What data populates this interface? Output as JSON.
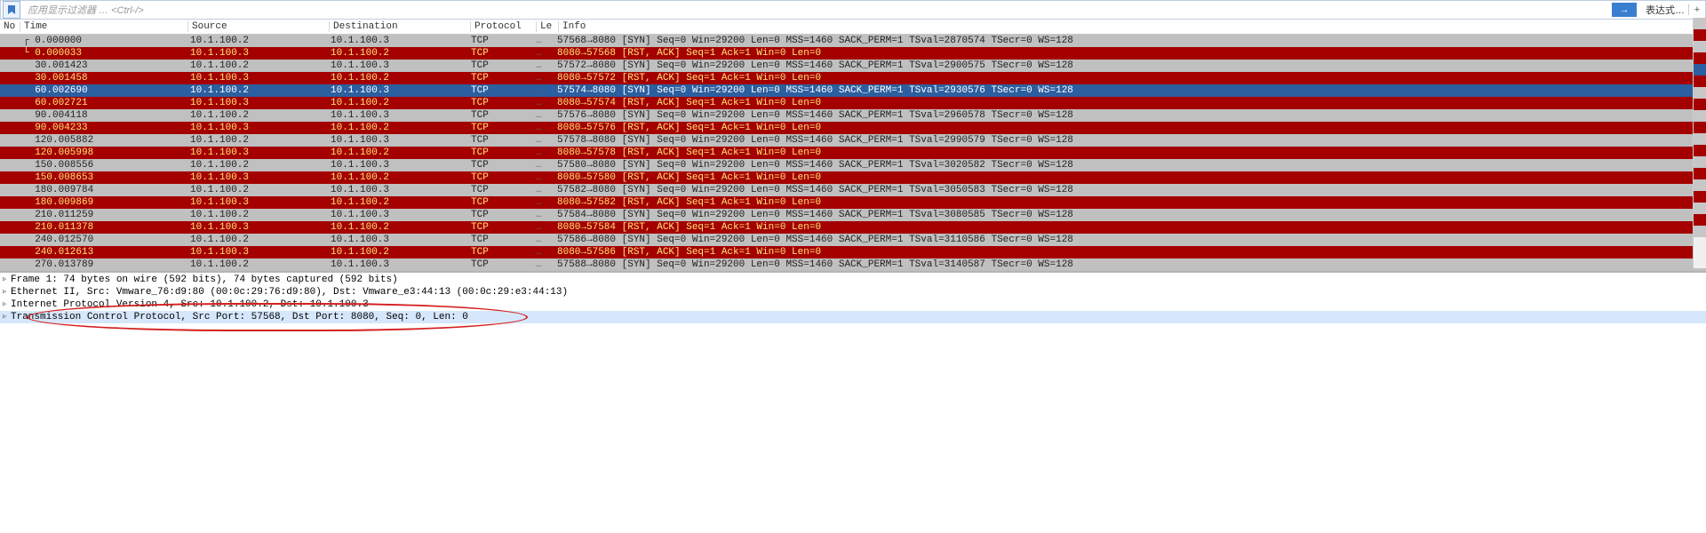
{
  "toolbar": {
    "filter_label": "应用显示过滤器 … <Ctrl-/>",
    "expr_label": "表达式…",
    "plus": "+",
    "arrow": "→"
  },
  "columns": {
    "no": "No",
    "time": "Time",
    "src": "Source",
    "dst": "Destination",
    "proto": "Protocol",
    "len": "Le",
    "info": "Info"
  },
  "packets": [
    {
      "style": "grey",
      "selmark": "┌ ",
      "time": "0.000000",
      "src": "10.1.100.2",
      "dst": "10.1.100.3",
      "proto": "TCP",
      "len": "…",
      "info": "57568→8080 [SYN] Seq=0 Win=29200 Len=0 MSS=1460 SACK_PERM=1 TSval=2870574 TSecr=0 WS=128"
    },
    {
      "style": "red",
      "selmark": "└ ",
      "time": "0.000033",
      "src": "10.1.100.3",
      "dst": "10.1.100.2",
      "proto": "TCP",
      "len": "…",
      "info": "8080→57568 [RST, ACK] Seq=1 Ack=1 Win=0 Len=0"
    },
    {
      "style": "grey",
      "selmark": "  ",
      "time": "30.001423",
      "src": "10.1.100.2",
      "dst": "10.1.100.3",
      "proto": "TCP",
      "len": "…",
      "info": "57572→8080 [SYN] Seq=0 Win=29200 Len=0 MSS=1460 SACK_PERM=1 TSval=2900575 TSecr=0 WS=128"
    },
    {
      "style": "red",
      "selmark": "  ",
      "time": "30.001458",
      "src": "10.1.100.3",
      "dst": "10.1.100.2",
      "proto": "TCP",
      "len": "…",
      "info": "8080→57572 [RST, ACK] Seq=1 Ack=1 Win=0 Len=0"
    },
    {
      "style": "sel",
      "selmark": "  ",
      "time": "60.002690",
      "src": "10.1.100.2",
      "dst": "10.1.100.3",
      "proto": "TCP",
      "len": "…",
      "info": "57574→8080 [SYN] Seq=0 Win=29200 Len=0 MSS=1460 SACK_PERM=1 TSval=2930576 TSecr=0 WS=128"
    },
    {
      "style": "red",
      "selmark": "  ",
      "time": "60.002721",
      "src": "10.1.100.3",
      "dst": "10.1.100.2",
      "proto": "TCP",
      "len": "…",
      "info": "8080→57574 [RST, ACK] Seq=1 Ack=1 Win=0 Len=0"
    },
    {
      "style": "grey",
      "selmark": "  ",
      "time": "90.004118",
      "src": "10.1.100.2",
      "dst": "10.1.100.3",
      "proto": "TCP",
      "len": "…",
      "info": "57576→8080 [SYN] Seq=0 Win=29200 Len=0 MSS=1460 SACK_PERM=1 TSval=2960578 TSecr=0 WS=128"
    },
    {
      "style": "red",
      "selmark": "  ",
      "time": "90.004233",
      "src": "10.1.100.3",
      "dst": "10.1.100.2",
      "proto": "TCP",
      "len": "…",
      "info": "8080→57576 [RST, ACK] Seq=1 Ack=1 Win=0 Len=0"
    },
    {
      "style": "grey",
      "selmark": "  ",
      "time": "120.005882",
      "src": "10.1.100.2",
      "dst": "10.1.100.3",
      "proto": "TCP",
      "len": "…",
      "info": "57578→8080 [SYN] Seq=0 Win=29200 Len=0 MSS=1460 SACK_PERM=1 TSval=2990579 TSecr=0 WS=128"
    },
    {
      "style": "red",
      "selmark": "  ",
      "time": "120.005998",
      "src": "10.1.100.3",
      "dst": "10.1.100.2",
      "proto": "TCP",
      "len": "…",
      "info": "8080→57578 [RST, ACK] Seq=1 Ack=1 Win=0 Len=0"
    },
    {
      "style": "grey",
      "selmark": "  ",
      "time": "150.008556",
      "src": "10.1.100.2",
      "dst": "10.1.100.3",
      "proto": "TCP",
      "len": "…",
      "info": "57580→8080 [SYN] Seq=0 Win=29200 Len=0 MSS=1460 SACK_PERM=1 TSval=3020582 TSecr=0 WS=128"
    },
    {
      "style": "red",
      "selmark": "  ",
      "time": "150.008653",
      "src": "10.1.100.3",
      "dst": "10.1.100.2",
      "proto": "TCP",
      "len": "…",
      "info": "8080→57580 [RST, ACK] Seq=1 Ack=1 Win=0 Len=0"
    },
    {
      "style": "grey",
      "selmark": "  ",
      "time": "180.009784",
      "src": "10.1.100.2",
      "dst": "10.1.100.3",
      "proto": "TCP",
      "len": "…",
      "info": "57582→8080 [SYN] Seq=0 Win=29200 Len=0 MSS=1460 SACK_PERM=1 TSval=3050583 TSecr=0 WS=128"
    },
    {
      "style": "red",
      "selmark": "  ",
      "time": "180.009869",
      "src": "10.1.100.3",
      "dst": "10.1.100.2",
      "proto": "TCP",
      "len": "…",
      "info": "8080→57582 [RST, ACK] Seq=1 Ack=1 Win=0 Len=0"
    },
    {
      "style": "grey",
      "selmark": "  ",
      "time": "210.011259",
      "src": "10.1.100.2",
      "dst": "10.1.100.3",
      "proto": "TCP",
      "len": "…",
      "info": "57584→8080 [SYN] Seq=0 Win=29200 Len=0 MSS=1460 SACK_PERM=1 TSval=3080585 TSecr=0 WS=128"
    },
    {
      "style": "red",
      "selmark": "  ",
      "time": "210.011378",
      "src": "10.1.100.3",
      "dst": "10.1.100.2",
      "proto": "TCP",
      "len": "…",
      "info": "8080→57584 [RST, ACK] Seq=1 Ack=1 Win=0 Len=0"
    },
    {
      "style": "grey",
      "selmark": "  ",
      "time": "240.012570",
      "src": "10.1.100.2",
      "dst": "10.1.100.3",
      "proto": "TCP",
      "len": "…",
      "info": "57586→8080 [SYN] Seq=0 Win=29200 Len=0 MSS=1460 SACK_PERM=1 TSval=3110586 TSecr=0 WS=128"
    },
    {
      "style": "red",
      "selmark": "  ",
      "time": "240.012613",
      "src": "10.1.100.3",
      "dst": "10.1.100.2",
      "proto": "TCP",
      "len": "…",
      "info": "8080→57586 [RST, ACK] Seq=1 Ack=1 Win=0 Len=0"
    },
    {
      "style": "grey",
      "selmark": "  ",
      "time": "270.013789",
      "src": "10.1.100.2",
      "dst": "10.1.100.3",
      "proto": "TCP",
      "len": "…",
      "info": "57588→8080 [SYN] Seq=0 Win=29200 Len=0 MSS=1460 SACK_PERM=1 TSval=3140587 TSecr=0 WS=128"
    }
  ],
  "details": {
    "frame": "Frame 1: 74 bytes on wire (592 bits), 74 bytes captured (592 bits)",
    "eth": "Ethernet II, Src: Vmware_76:d9:80 (00:0c:29:76:d9:80), Dst: Vmware_e3:44:13 (00:0c:29:e3:44:13)",
    "ip": "Internet Protocol Version 4, Src: 10.1.100.2, Dst: 10.1.100.3",
    "tcp": "Transmission Control Protocol, Src Port: 57568, Dst Port: 8080, Seq: 0, Len: 0"
  }
}
